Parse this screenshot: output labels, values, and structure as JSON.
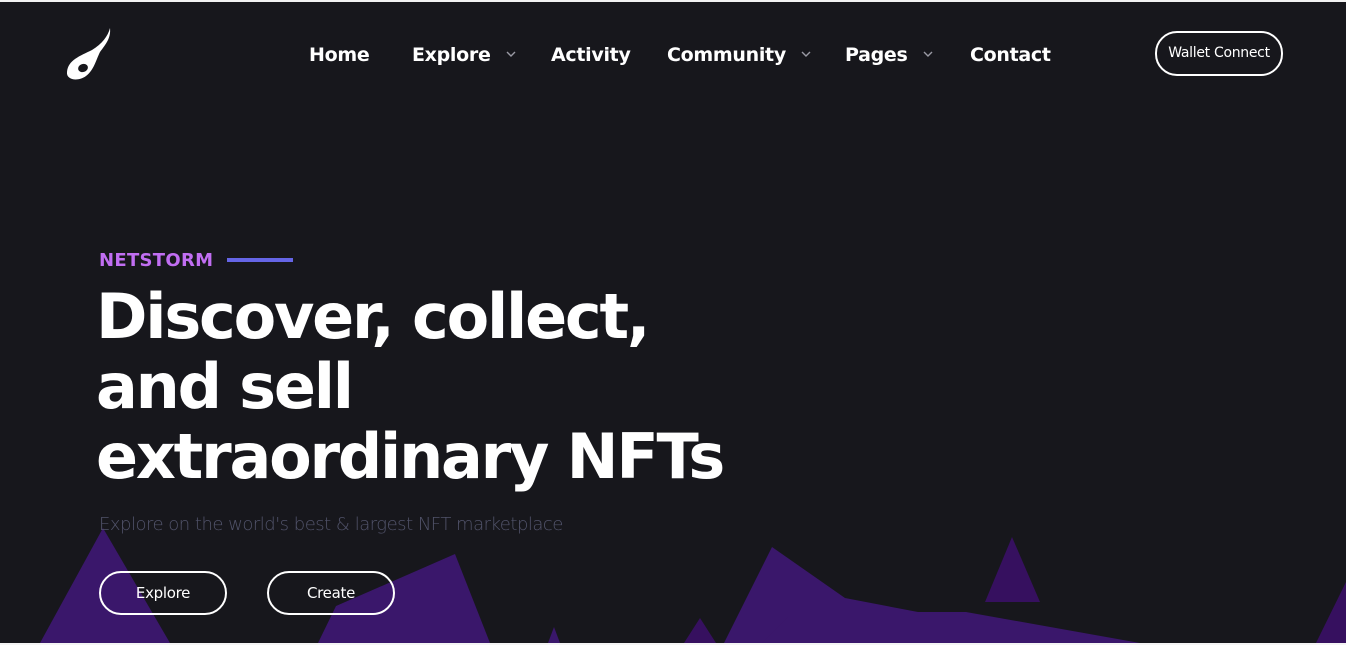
{
  "brand": {
    "logo_icon": "flame-drop-logo-icon"
  },
  "nav": {
    "items": [
      {
        "label": "Home",
        "has_dropdown": false
      },
      {
        "label": "Explore",
        "has_dropdown": true
      },
      {
        "label": "Activity",
        "has_dropdown": false
      },
      {
        "label": "Community",
        "has_dropdown": true
      },
      {
        "label": "Pages",
        "has_dropdown": true
      },
      {
        "label": "Contact",
        "has_dropdown": false
      }
    ],
    "wallet_button": "Wallet Connect"
  },
  "hero": {
    "eyebrow": "NETSTORM",
    "headline_lines": [
      "Discover, collect,",
      "and sell",
      "extraordinary NFTs"
    ],
    "subtitle": "Explore on the world's best & largest NFT marketplace",
    "buttons": {
      "explore": "Explore",
      "create": "Create"
    }
  },
  "colors": {
    "background": "#17171c",
    "accent_purple": "#c16ef2",
    "accent_line": "#6565e6",
    "mountain_light": "#3a176b",
    "mountain_dark": "#36105f",
    "subtitle": "#51536a",
    "text": "#ffffff"
  }
}
